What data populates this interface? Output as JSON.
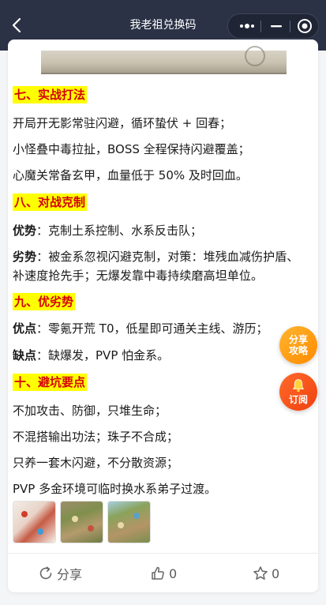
{
  "nav": {
    "title": "我老祖兑换码",
    "back_icon": "chevron-left-icon",
    "more_icon": "more-dots-icon",
    "minimize_icon": "minus-icon",
    "close_icon": "target-close-icon"
  },
  "article": {
    "sections": [
      {
        "heading": "七、实战打法",
        "lines": [
          "开局开无影常驻闪避，循环蛰伏 + 回春；",
          "小怪叠中毒拉扯，BOSS 全程保持闪避覆盖；",
          "心魔关常备玄甲，血量低于 50% 及时回血。"
        ]
      },
      {
        "heading": "八、对战克制",
        "strength_label": "优势",
        "strength_text": "：克制土系控制、水系反击队；",
        "weakness_label": "劣势",
        "weakness_text": "：被金系忽视闪避克制，对策：堆残血减伤护盾、补速度抢先手；无爆发靠中毒持续磨高坦单位。"
      },
      {
        "heading": "九、优劣势",
        "pros_label": "优点",
        "pros_text": "：零氪开荒 T0，低星即可通关主线、游历；",
        "cons_label": "缺点",
        "cons_text": "：缺爆发，PVP 怕金系。"
      },
      {
        "heading": "十、避坑要点",
        "lines": [
          "不加攻击、防御，只堆生命；",
          "不混搭输出功法；珠子不合成；",
          "只养一套木闪避，不分散资源；",
          "PVP 多金环境可临时换水系弟子过渡。"
        ]
      }
    ]
  },
  "actions": {
    "share_label": "分享",
    "share_icon": "share-icon",
    "like_count": "0",
    "like_icon": "thumbs-up-icon",
    "star_count": "0",
    "star_icon": "star-icon"
  },
  "floating": {
    "share_guide_line1": "分享",
    "share_guide_line2": "攻略",
    "subscribe_label": "订阅",
    "subscribe_icon": "bell-icon"
  },
  "colors": {
    "nav_bg": "#2b3246",
    "heading_bg": "#ffff00",
    "heading_text": "#d4000a",
    "float_share": "#ff9a14",
    "float_subscribe": "#f5501a"
  }
}
